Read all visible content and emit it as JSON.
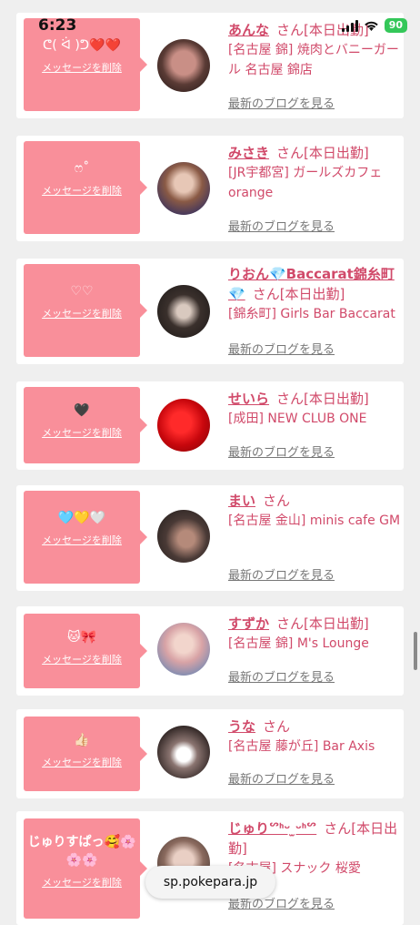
{
  "status_bar": {
    "time": "6:23",
    "battery": "90"
  },
  "delete_label": "メッセージを削除",
  "blog_label": "最新のブログを見る",
  "san": "さん",
  "url": "sp.pokepara.jp",
  "cards": [
    {
      "message": "ᕦ( ᐛ )ᕤ❤️❤️",
      "name": "あんな",
      "attendance": "[本日出勤]",
      "shop": "[名古屋 錦] 焼肉とバニーガール 名古屋 錦店"
    },
    {
      "message": "ෆ˚",
      "name": "みさき",
      "attendance": "[本日出勤]",
      "shop": "[JR宇都宮] ガールズカフェ orange"
    },
    {
      "message": "♡♡",
      "name": "りおん💎Baccarat錦糸町💎",
      "attendance": "[本日出勤]",
      "shop": "[錦糸町] Girls Bar Baccarat"
    },
    {
      "message": "🖤",
      "name": "せいら",
      "attendance": "[本日出勤]",
      "shop": "[成田] NEW CLUB ONE"
    },
    {
      "message": "🩵💛🤍",
      "name": "まい",
      "attendance": "",
      "shop": "[名古屋 金山] minis cafe GM"
    },
    {
      "message": "🐱🎀",
      "name": "すずか",
      "attendance": "[本日出勤]",
      "shop": "[名古屋 錦] M's Lounge"
    },
    {
      "message": "👍🏻",
      "name": "うな",
      "attendance": "",
      "shop": "[名古屋 藤が丘] Bar Axis"
    },
    {
      "message": "じゅりすぱっ🥰🌸🌸🌸",
      "name": "じゅりᔥᑋ︎ᵕ︎ ̫ᵕ︎ᑋ︎ᔥ",
      "attendance": "[本日出勤]",
      "shop": "[名古屋] スナック 桜愛"
    }
  ]
}
